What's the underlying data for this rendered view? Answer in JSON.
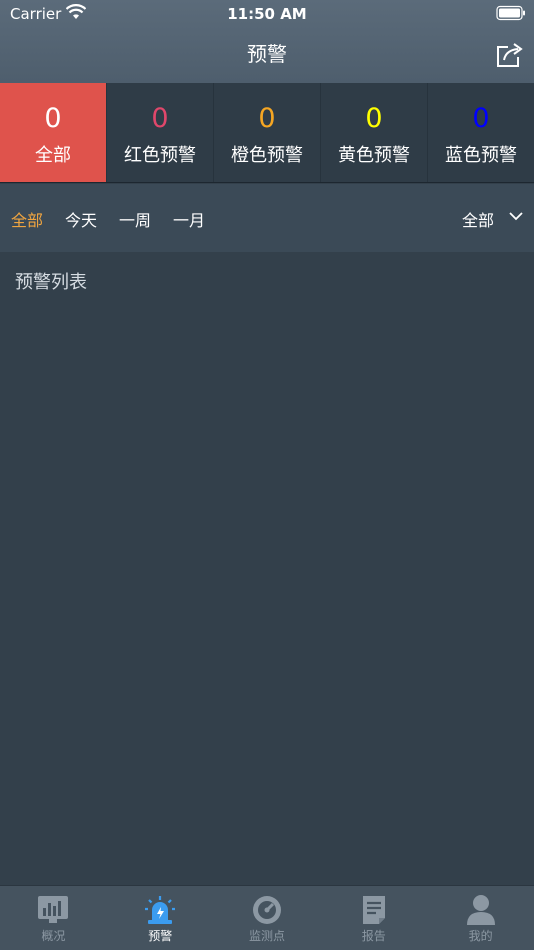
{
  "status": {
    "carrier": "Carrier",
    "time": "11:50 AM"
  },
  "nav": {
    "title": "预警"
  },
  "tabs": [
    {
      "count": "0",
      "label": "全部",
      "color": "#ffffff"
    },
    {
      "count": "0",
      "label": "红色预警",
      "color": "#e0476b"
    },
    {
      "count": "0",
      "label": "橙色预警",
      "color": "#f5a623"
    },
    {
      "count": "0",
      "label": "黄色预警",
      "color": "#ffff00"
    },
    {
      "count": "0",
      "label": "蓝色预警",
      "color": "#0000ff"
    }
  ],
  "filter": {
    "options": [
      "全部",
      "今天",
      "一周",
      "一月"
    ],
    "dropdown": "全部"
  },
  "list": {
    "heading": "预警列表"
  },
  "tabbar": {
    "items": [
      {
        "label": "概况",
        "icon": "chart-icon"
      },
      {
        "label": "预警",
        "icon": "alarm-icon"
      },
      {
        "label": "监测点",
        "icon": "gauge-icon"
      },
      {
        "label": "报告",
        "icon": "report-icon"
      },
      {
        "label": "我的",
        "icon": "user-icon"
      }
    ]
  }
}
